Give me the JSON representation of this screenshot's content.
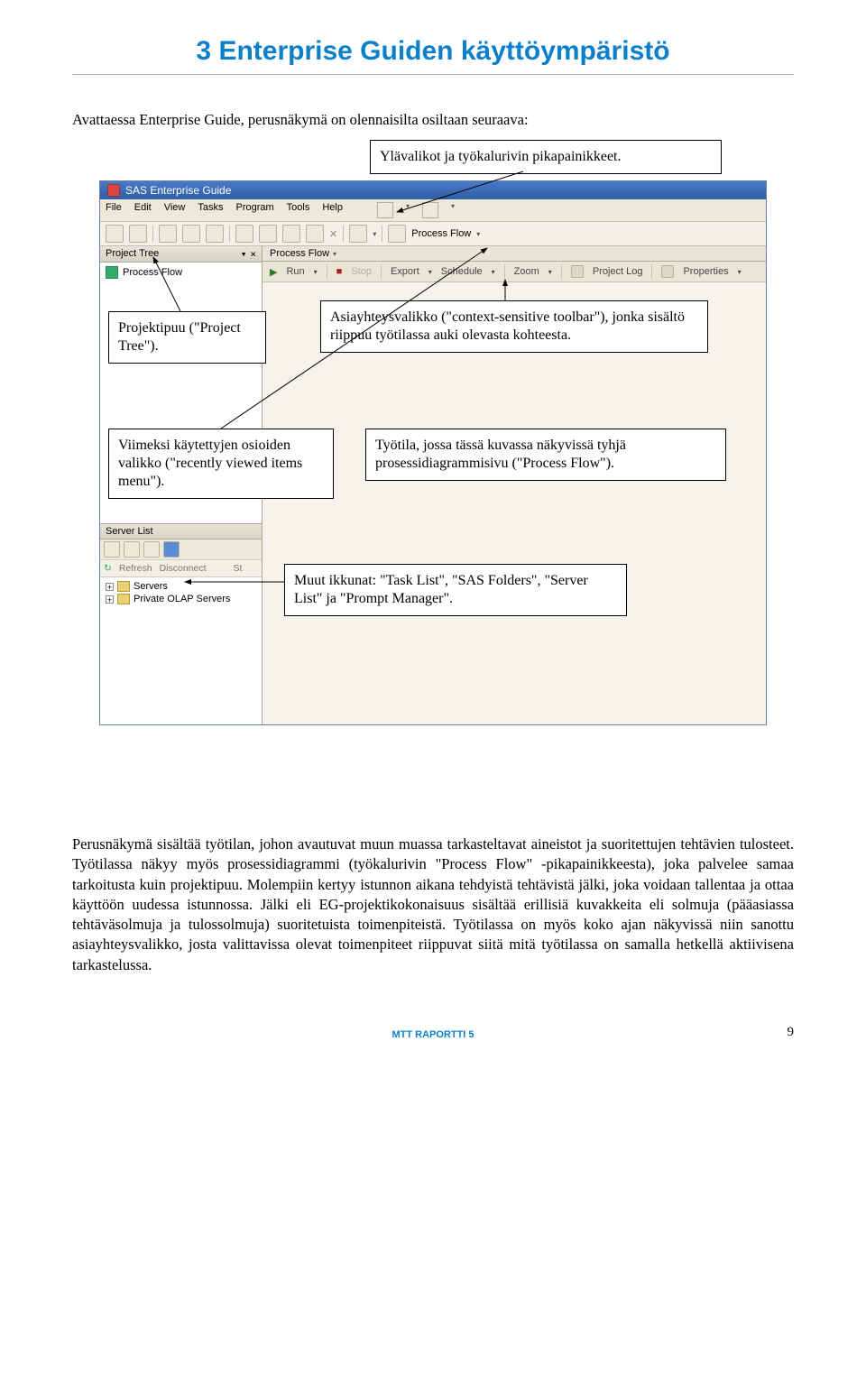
{
  "chapter_title": "3 Enterprise Guiden käyttöympäristö",
  "intro": "Avattaessa Enterprise Guide, perusnäkymä on olennaisilta osiltaan seuraava:",
  "callouts": {
    "top_menus": "Ylävalikot ja työkalurivin pikapainikkeet.",
    "project_tree": "Projektipuu (\"Project Tree\").",
    "context_toolbar": "Asiayhteysvalikko (\"context-sensitive toolbar\"), jonka sisältö riippuu työtilassa auki olevasta kohteesta.",
    "recent_menu": "Viimeksi käytettyjen osioiden valikko (\"recently viewed items menu\").",
    "process_flow": "Työtila, jossa tässä kuvassa näkyvissä tyhjä prosessidiagrammisivu (\"Process Flow\").",
    "other_windows": "Muut ikkunat: \"Task List\", \"SAS Folders\", \"Server List\" ja \"Prompt Manager\"."
  },
  "eg": {
    "title": "SAS Enterprise Guide",
    "menu": [
      "File",
      "Edit",
      "View",
      "Tasks",
      "Program",
      "Tools",
      "Help"
    ],
    "left_pane_title": "Project Tree",
    "process_flow_item": "Process Flow",
    "server_list_title": "Server List",
    "sl_refresh": "Refresh",
    "sl_disconnect": "Disconnect",
    "sl_st": "St",
    "tree_servers": "Servers",
    "tree_olap": "Private OLAP Servers",
    "pf_title": "Process Flow",
    "pf": {
      "run": "Run",
      "stop": "Stop",
      "export": "Export",
      "schedule": "Schedule",
      "zoom": "Zoom",
      "project_log": "Project Log",
      "properties": "Properties"
    },
    "quick_process_flow": "Process Flow"
  },
  "body_text": "Perusnäkymä sisältää työtilan, johon avautuvat muun muassa tarkasteltavat aineistot ja suoritettujen tehtävien tulosteet. Työtilassa näkyy myös prosessidiagrammi (työkalurivin \"Process Flow\" -pikapainikkeesta), joka palvelee samaa tarkoitusta kuin projektipuu. Molempiin kertyy istunnon aikana tehdyistä tehtävistä jälki, joka voidaan tallentaa ja ottaa käyttöön uudessa istunnossa. Jälki eli EG-projektikokonaisuus sisältää erillisiä kuvakkeita eli solmuja (pääasiassa tehtäväsolmuja ja tulossolmuja) suoritetuista toimenpiteistä. Työtilassa on myös koko ajan näkyvissä niin sanottu asiayhteysvalikko, josta valittavissa olevat toimenpiteet riippuvat siitä mitä työtilassa on samalla hetkellä aktiivisena tarkastelussa.",
  "footer": "MTT RAPORTTI 5",
  "page_number": "9"
}
